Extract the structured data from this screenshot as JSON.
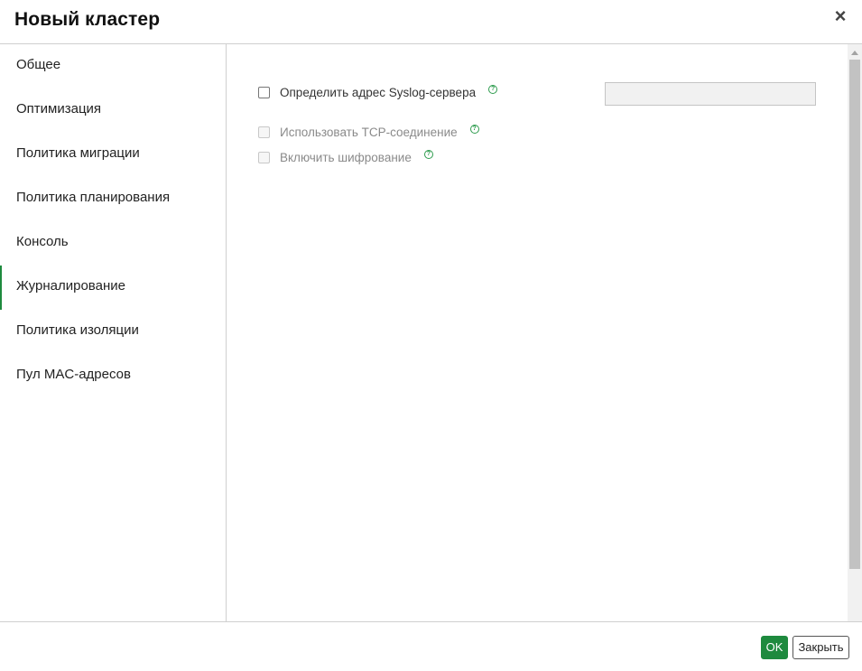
{
  "dialog": {
    "title": "Новый кластер",
    "close_icon": "×"
  },
  "sidebar": {
    "items": [
      {
        "label": "Общее",
        "active": false
      },
      {
        "label": "Оптимизация",
        "active": false
      },
      {
        "label": "Политика миграции",
        "active": false
      },
      {
        "label": "Политика планирования",
        "active": false
      },
      {
        "label": "Консоль",
        "active": false
      },
      {
        "label": "Журналирование",
        "active": true
      },
      {
        "label": "Политика изоляции",
        "active": false
      },
      {
        "label": "Пул MAC-адресов",
        "active": false
      }
    ]
  },
  "logging": {
    "syslog": {
      "label": "Определить адрес Syslog-сервера",
      "checked": false,
      "value": ""
    },
    "tcp": {
      "label": "Использовать TCP-соединение",
      "checked": false,
      "disabled": true
    },
    "encryption": {
      "label": "Включить шифрование",
      "checked": false,
      "disabled": true
    },
    "help_glyph": "?"
  },
  "footer": {
    "ok_label": "OK",
    "close_label": "Закрыть"
  },
  "colors": {
    "accent": "#1e8a3e"
  }
}
